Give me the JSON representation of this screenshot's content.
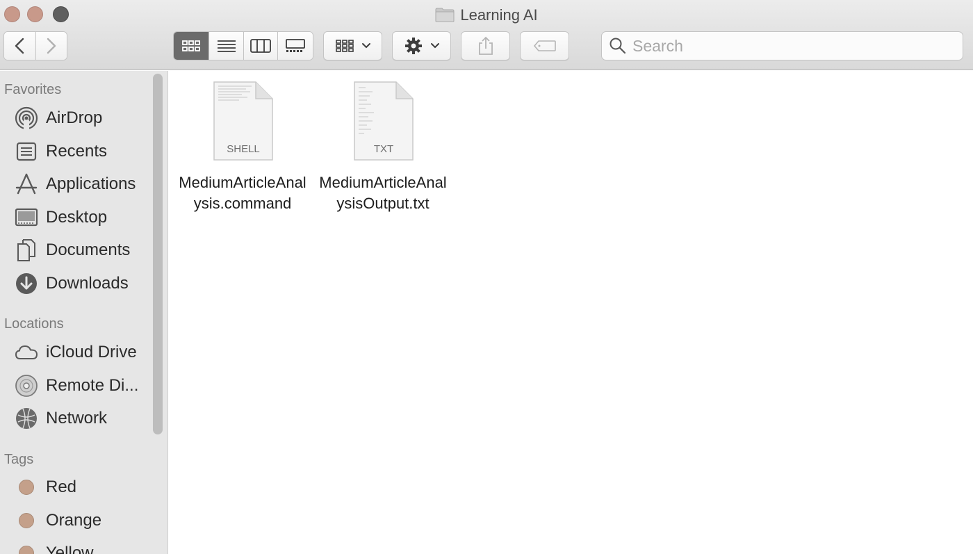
{
  "window": {
    "title": "Learning AI"
  },
  "toolbar": {
    "back_icon": "chevron-left-icon",
    "forward_icon": "chevron-right-icon",
    "view_modes": [
      "icon-view",
      "list-view",
      "column-view",
      "gallery-view"
    ],
    "active_view": "icon-view",
    "search_placeholder": "Search",
    "search_value": ""
  },
  "sidebar": {
    "favorites_title": "Favorites",
    "favorites": [
      {
        "label": "AirDrop",
        "icon": "airdrop-icon"
      },
      {
        "label": "Recents",
        "icon": "recents-icon"
      },
      {
        "label": "Applications",
        "icon": "applications-icon"
      },
      {
        "label": "Desktop",
        "icon": "desktop-icon"
      },
      {
        "label": "Documents",
        "icon": "documents-icon"
      },
      {
        "label": "Downloads",
        "icon": "downloads-icon"
      }
    ],
    "locations_title": "Locations",
    "locations": [
      {
        "label": "iCloud Drive",
        "icon": "cloud-icon"
      },
      {
        "label": "Remote Di...",
        "icon": "disc-icon"
      },
      {
        "label": "Network",
        "icon": "network-icon"
      }
    ],
    "tags_title": "Tags",
    "tags": [
      {
        "label": "Red",
        "color": "#c4a08a"
      },
      {
        "label": "Orange",
        "color": "#c4a08a"
      },
      {
        "label": "Yellow",
        "color": "#c4a08a"
      }
    ]
  },
  "files": [
    {
      "name": "MediumArticleAnalysis.command",
      "badge": "SHELL"
    },
    {
      "name": "MediumArticleAnalysisOutput.txt",
      "badge": "TXT"
    }
  ]
}
